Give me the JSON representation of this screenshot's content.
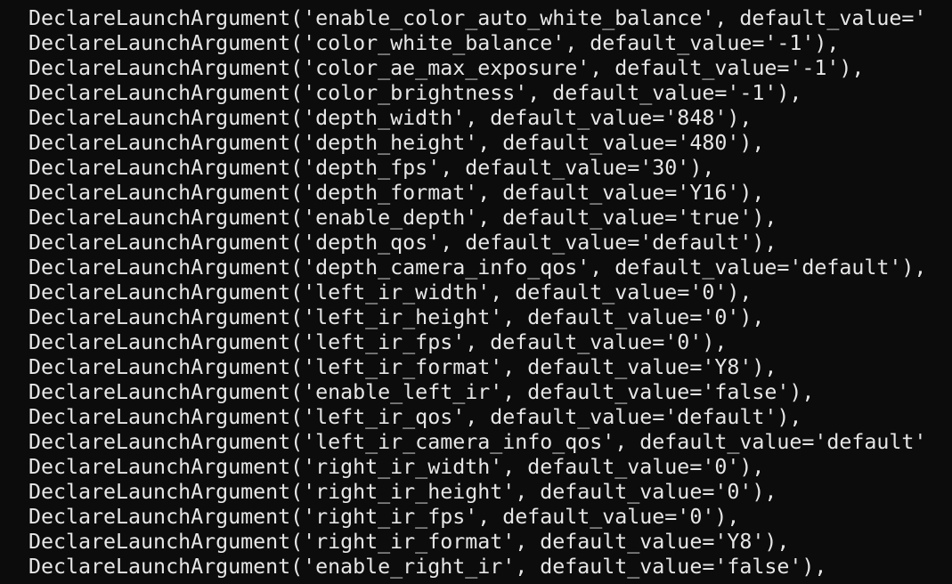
{
  "terminal": {
    "background": "#0c0c0c",
    "foreground": "#e6e6e6",
    "lines": [
      "DeclareLaunchArgument('enable_color_auto_white_balance', default_value='",
      "DeclareLaunchArgument('color_white_balance', default_value='-1'),",
      "DeclareLaunchArgument('color_ae_max_exposure', default_value='-1'),",
      "DeclareLaunchArgument('color_brightness', default_value='-1'),",
      "DeclareLaunchArgument('depth_width', default_value='848'),",
      "DeclareLaunchArgument('depth_height', default_value='480'),",
      "DeclareLaunchArgument('depth_fps', default_value='30'),",
      "DeclareLaunchArgument('depth_format', default_value='Y16'),",
      "DeclareLaunchArgument('enable_depth', default_value='true'),",
      "DeclareLaunchArgument('depth_qos', default_value='default'),",
      "DeclareLaunchArgument('depth_camera_info_qos', default_value='default'),",
      "DeclareLaunchArgument('left_ir_width', default_value='0'),",
      "DeclareLaunchArgument('left_ir_height', default_value='0'),",
      "DeclareLaunchArgument('left_ir_fps', default_value='0'),",
      "DeclareLaunchArgument('left_ir_format', default_value='Y8'),",
      "DeclareLaunchArgument('enable_left_ir', default_value='false'),",
      "DeclareLaunchArgument('left_ir_qos', default_value='default'),",
      "DeclareLaunchArgument('left_ir_camera_info_qos', default_value='default'",
      "DeclareLaunchArgument('right_ir_width', default_value='0'),",
      "DeclareLaunchArgument('right_ir_height', default_value='0'),",
      "DeclareLaunchArgument('right_ir_fps', default_value='0'),",
      "DeclareLaunchArgument('right_ir_format', default_value='Y8'),",
      "DeclareLaunchArgument('enable_right_ir', default_value='false'),"
    ]
  }
}
